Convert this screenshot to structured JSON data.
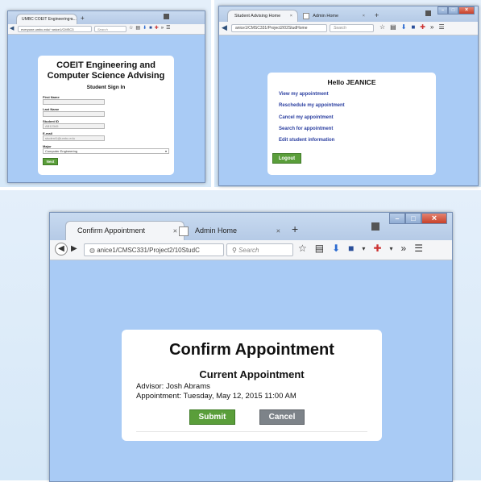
{
  "signin": {
    "tab_title": "UMBC COEIT Engineering a...",
    "url": "everyone.umbc.edu/~anice1/CMSC3",
    "search_placeholder": "Search",
    "heading_line1": "COEIT Engineering and",
    "heading_line2": "Computer Science Advising",
    "subheading": "Student Sign In",
    "fields": [
      {
        "label": "First Name",
        "value": ""
      },
      {
        "label": "Last Name",
        "value": ""
      },
      {
        "label": "Student ID",
        "value": "AB12345"
      },
      {
        "label": "E-mail",
        "value": "student1@umbc.edu"
      }
    ],
    "major_label": "Major",
    "major_value": "Computer Engineering",
    "next_label": "Next"
  },
  "advising_home": {
    "tab1_title": "Student Advising Home",
    "tab2_title": "Admin Home",
    "url": "anice1/CMSC331/Project2/02StudHome",
    "search_placeholder": "Search",
    "greeting": "Hello JEANICE",
    "links": [
      "View my appointment",
      "Reschedule my appointment",
      "Cancel my appointment",
      "Search for appointment",
      "Edit student information"
    ],
    "logout_label": "Logout"
  },
  "confirm": {
    "tab1_title": "Confirm Appointment",
    "tab2_title": "Admin Home",
    "url": "anice1/CMSC331/Project2/10StudC",
    "search_placeholder": "Search",
    "title": "Confirm Appointment",
    "subtitle": "Current Appointment",
    "advisor_line": "Advisor: Josh Abrams",
    "appointment_line": "Appointment: Tuesday, May 12, 2015 11:00 AM",
    "submit_label": "Submit",
    "cancel_label": "Cancel"
  },
  "icons": {
    "back": "back-arrow-icon",
    "forward": "forward-arrow-icon",
    "reload": "reload-icon",
    "bookmark": "star-icon",
    "download": "download-icon",
    "menu": "hamburger-menu-icon"
  },
  "colors": {
    "page_bg": "#a9cbf5",
    "button_green": "#5a9e3a",
    "button_gray": "#7d8389",
    "link_blue": "#2b3fa0"
  }
}
